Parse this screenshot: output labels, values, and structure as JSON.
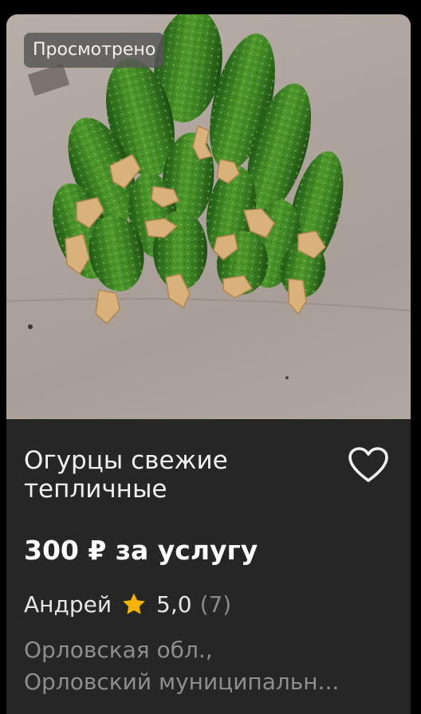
{
  "listing": {
    "badge": "Просмотрено",
    "title": "Огурцы свежие тепличные",
    "price": "300 ₽ за услугу",
    "seller": {
      "name": "Андрей",
      "rating": "5,0",
      "reviews": "(7)"
    },
    "location": {
      "line1": "Орловская обл.,",
      "line2": "Орловский муниципальн..."
    },
    "photo_subject": "pile of fresh green cucumbers on cardboard"
  },
  "colors": {
    "background": "#000000",
    "card": "#262626",
    "star": "#f5b301",
    "title_text": "#f0f0f0",
    "muted_text": "#8e8e8e"
  },
  "icons": {
    "favorite": "heart-outline-icon",
    "rating": "star-icon"
  }
}
